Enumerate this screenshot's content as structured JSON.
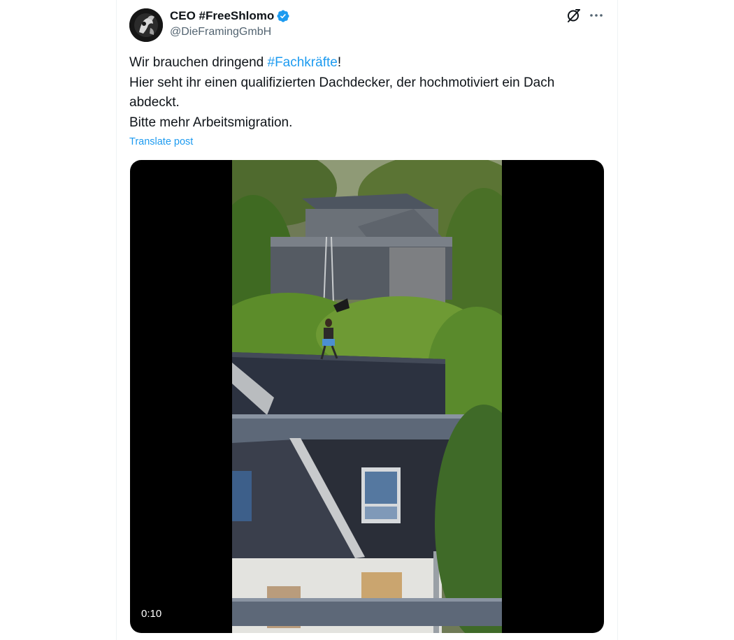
{
  "author": {
    "display_name": "CEO #FreeShlomo",
    "handle": "@DieFramingGmbH",
    "verified": true
  },
  "post": {
    "line1_prefix": "Wir brauchen dringend ",
    "line1_hashtag": "#Fachkräfte",
    "line1_suffix": "!",
    "line2": "Hier seht ihr einen qualifizierten Dachdecker, der hochmotiviert ein Dach",
    "line3": "abdeckt.",
    "line4": "Bitte mehr Arbeitsmigration.",
    "translate_label": "Translate post"
  },
  "media": {
    "type": "video",
    "duration": "0:10"
  },
  "icons": {
    "grok": "grok-icon",
    "more": "more-icon",
    "verified": "verified-badge-icon"
  },
  "colors": {
    "accent": "#1d9bf0",
    "text": "#0f1419",
    "muted": "#536471"
  }
}
